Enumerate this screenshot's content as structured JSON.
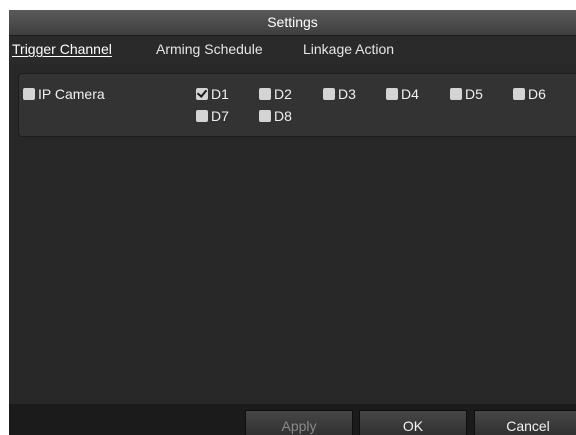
{
  "window": {
    "title": "Settings"
  },
  "tabs": [
    {
      "label": "Trigger Channel",
      "active": true
    },
    {
      "label": "Arming Schedule",
      "active": false
    },
    {
      "label": "Linkage Action",
      "active": false
    }
  ],
  "group": {
    "label": "IP Camera",
    "checked": false
  },
  "channels": [
    {
      "label": "D1",
      "checked": true
    },
    {
      "label": "D2",
      "checked": false
    },
    {
      "label": "D3",
      "checked": false
    },
    {
      "label": "D4",
      "checked": false
    },
    {
      "label": "D5",
      "checked": false
    },
    {
      "label": "D6",
      "checked": false
    },
    {
      "label": "D7",
      "checked": false
    },
    {
      "label": "D8",
      "checked": false
    }
  ],
  "buttons": {
    "apply": {
      "label": "Apply",
      "enabled": false
    },
    "ok": {
      "label": "OK",
      "enabled": true
    },
    "cancel": {
      "label": "Cancel",
      "enabled": true
    }
  }
}
